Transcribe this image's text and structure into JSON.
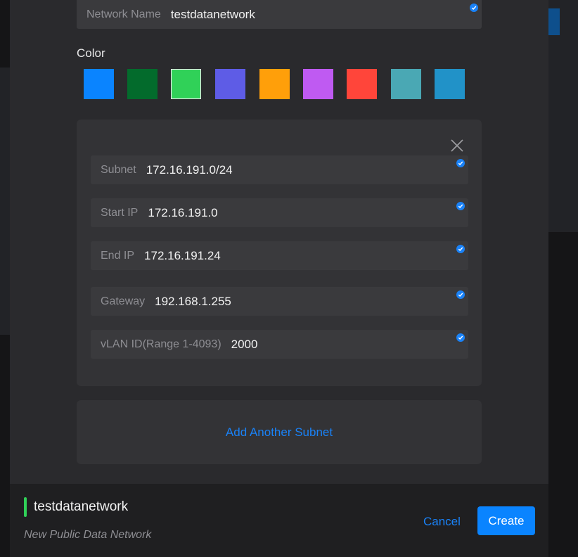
{
  "form": {
    "network_name": {
      "label": "Network Name",
      "value": "testdatanetwork"
    },
    "color_label": "Color",
    "colors": [
      "#0a84ff",
      "#036b2c",
      "#30d158",
      "#5e5ce6",
      "#ff9f0a",
      "#bf5af2",
      "#ff453a",
      "#4aa8b4",
      "#2192c8"
    ],
    "selected_color": "#30d158"
  },
  "subnet": {
    "fields": [
      {
        "label": "Subnet",
        "value": "172.16.191.0/24"
      },
      {
        "label": "Start IP",
        "value": "172.16.191.0"
      },
      {
        "label": "End IP",
        "value": "172.16.191.24"
      },
      {
        "label": "Gateway",
        "value": "192.168.1.255"
      },
      {
        "label": "vLAN ID(Range 1-4093)",
        "value": "2000"
      }
    ]
  },
  "add_subnet_label": "Add Another Subnet",
  "footer": {
    "name": "testdatanetwork",
    "subtitle": "New Public Data Network",
    "accent_color": "#30d158",
    "cancel_label": "Cancel",
    "create_label": "Create"
  }
}
